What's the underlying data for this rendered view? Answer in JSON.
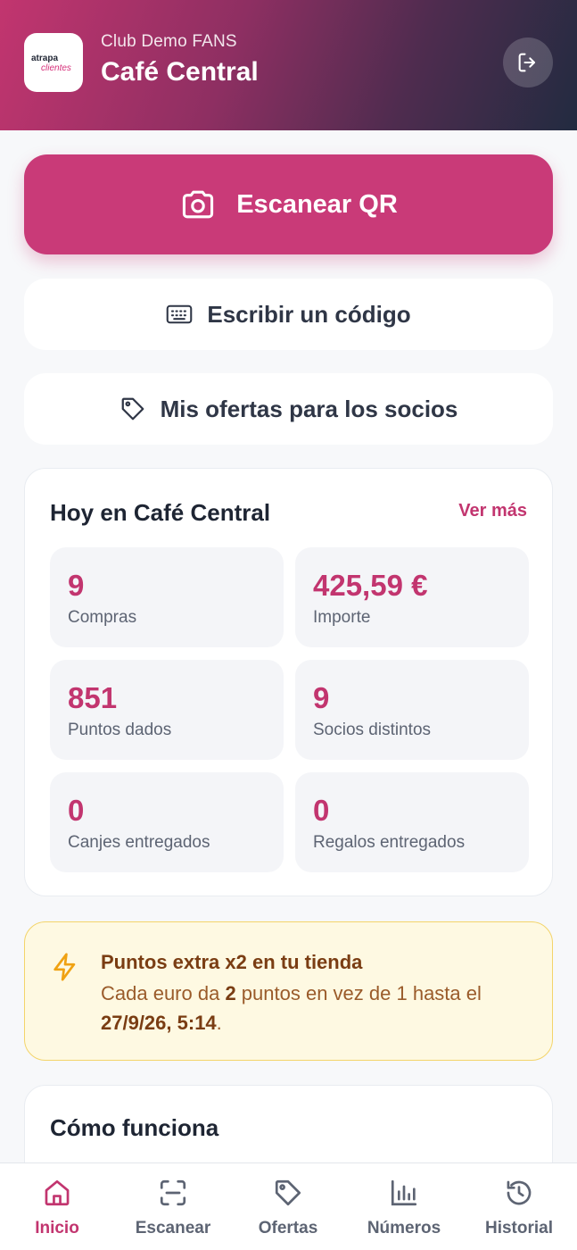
{
  "header": {
    "logo_text_top": "atrapa",
    "logo_text_bottom": "clientes",
    "club_name": "Club Demo FANS",
    "store_name": "Café Central"
  },
  "actions": {
    "scan_label": "Escanear QR",
    "code_label": "Escribir un código",
    "offers_label": "Mis ofertas para los socios"
  },
  "today": {
    "title": "Hoy en Café Central",
    "see_more": "Ver más",
    "stats": [
      {
        "value": "9",
        "label": "Compras"
      },
      {
        "value": "425,59 €",
        "label": "Importe"
      },
      {
        "value": "851",
        "label": "Puntos dados"
      },
      {
        "value": "9",
        "label": "Socios distintos"
      },
      {
        "value": "0",
        "label": "Canjes entregados"
      },
      {
        "value": "0",
        "label": "Regalos entregados"
      }
    ]
  },
  "promo": {
    "title": "Puntos extra x2 en tu tienda",
    "text_1": "Cada euro da ",
    "multiplier": "2",
    "text_2": " puntos en vez de 1 hasta el ",
    "until": "27/9/26, 5:14",
    "text_3": "."
  },
  "how": {
    "title": "Cómo funciona"
  },
  "nav": {
    "items": [
      {
        "label": "Inicio",
        "icon": "home-icon",
        "active": true
      },
      {
        "label": "Escanear",
        "icon": "scan-icon",
        "active": false
      },
      {
        "label": "Ofertas",
        "icon": "tag-icon",
        "active": false
      },
      {
        "label": "Números",
        "icon": "bar-chart-icon",
        "active": false
      },
      {
        "label": "Historial",
        "icon": "history-icon",
        "active": false
      }
    ]
  },
  "colors": {
    "brand": "#c93a78",
    "accent_text": "#c2356f",
    "promo_bg": "#fef9e2",
    "promo_border": "#f3d46a"
  }
}
